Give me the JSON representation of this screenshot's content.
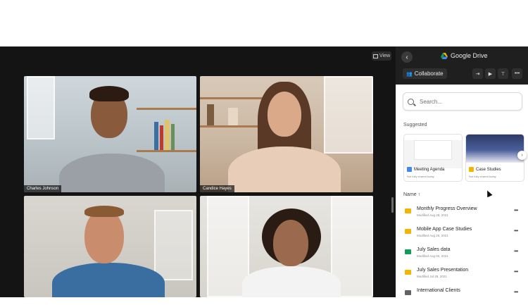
{
  "meeting": {
    "view_label": "View",
    "participants": [
      {
        "name": "Charles Johnson"
      },
      {
        "name": "Candice Hayes"
      },
      {
        "name": ""
      },
      {
        "name": ""
      }
    ]
  },
  "panel": {
    "back_icon": "chevron-left-icon",
    "title": "Google Drive",
    "collaborate_label": "Collaborate",
    "toolbar_icons": [
      "split-icon",
      "youtube-icon",
      "pin-icon",
      "more-icon"
    ],
    "search_placeholder": "Search...",
    "suggested_label": "Suggested",
    "suggested": [
      {
        "title": "Meeting Agenda",
        "subtitle": "Not fully shared today",
        "type": "doc",
        "color": "#4285f4"
      },
      {
        "title": "Case Studies",
        "subtitle": "Not fully shared today",
        "type": "slides",
        "color": "#f4b400"
      }
    ],
    "name_header": "Name ↑",
    "files": [
      {
        "name": "Monthly Progress Overview",
        "modified": "Modified Aug 28, 2021",
        "type": "slides",
        "color": "#f4b400"
      },
      {
        "name": "Mobile App Case Studies",
        "modified": "Modified Aug 26, 2021",
        "type": "slides",
        "color": "#f4b400"
      },
      {
        "name": "July Sales data",
        "modified": "Modified Aug 02, 2021",
        "type": "sheet",
        "color": "#0f9d58"
      },
      {
        "name": "July Sales Presentation",
        "modified": "Modified Jul 28, 2021",
        "type": "slides",
        "color": "#f4b400"
      },
      {
        "name": "International Clients",
        "modified": "",
        "type": "folder",
        "color": "#5f6368"
      }
    ],
    "more_label": "•••"
  },
  "colors": {
    "stage_bg": "#141414",
    "panel_header_bg": "#1f1f1f",
    "panel_bg": "#ffffff"
  }
}
